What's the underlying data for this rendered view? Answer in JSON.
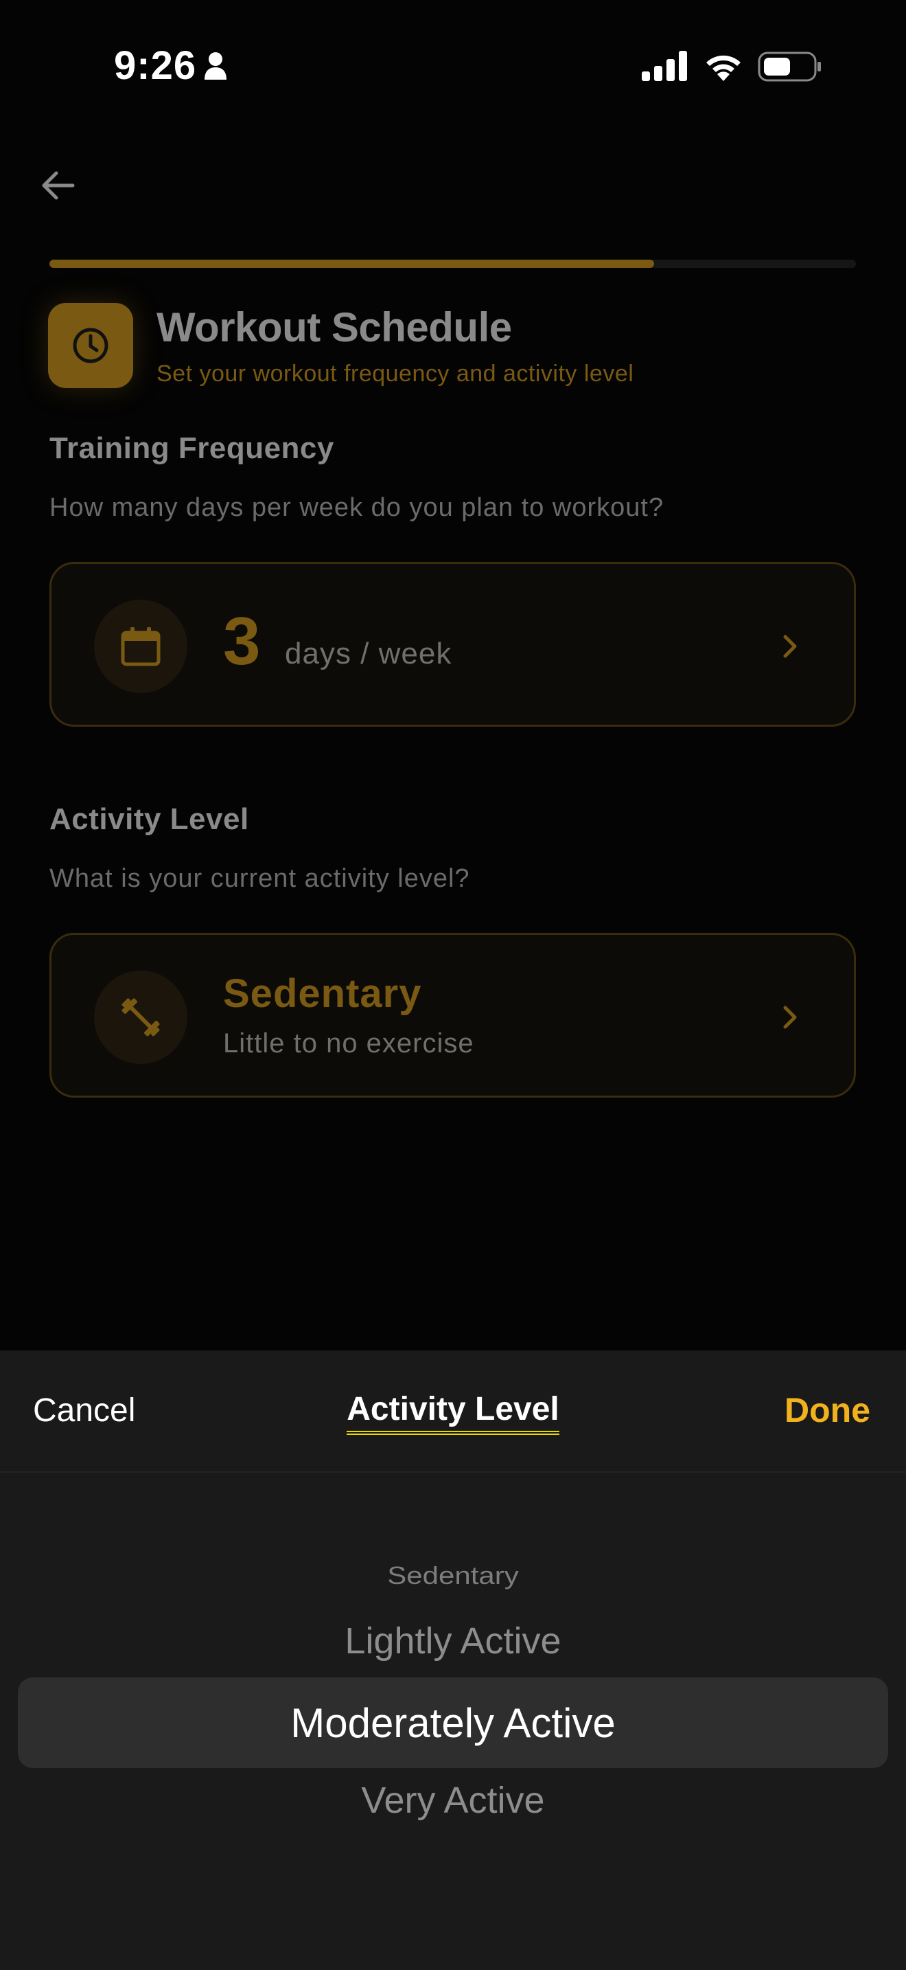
{
  "status_bar": {
    "time": "9:26"
  },
  "icons": {
    "person": "person-icon",
    "signal": "cellular-signal-icon",
    "wifi": "wifi-icon",
    "battery": "battery-icon",
    "back": "arrow-left-icon",
    "header": "clock-icon",
    "calendar": "calendar-icon",
    "activity": "dumbbell-icon",
    "chevron": "chevron-right-icon"
  },
  "progress": {
    "fraction": 0.75
  },
  "header": {
    "title": "Workout Schedule",
    "subtitle": "Set your workout frequency and activity level"
  },
  "training_frequency": {
    "title": "Training Frequency",
    "description": "How many days per week do you plan to workout?",
    "value": "3",
    "unit": "days / week"
  },
  "activity_level": {
    "title": "Activity Level",
    "description": "What is your current activity level?",
    "value": "Sedentary",
    "value_description": "Little to no exercise"
  },
  "picker": {
    "cancel_label": "Cancel",
    "title": "Activity Level",
    "done_label": "Done",
    "options": [
      "Sedentary",
      "Lightly Active",
      "Moderately Active",
      "Very Active"
    ],
    "selected": "Moderately Active"
  },
  "colors": {
    "accent": "#f2b21d",
    "accent_dim": "#7a5a13",
    "sheet_background": "#1a1a1a",
    "page_background": "#040404"
  }
}
